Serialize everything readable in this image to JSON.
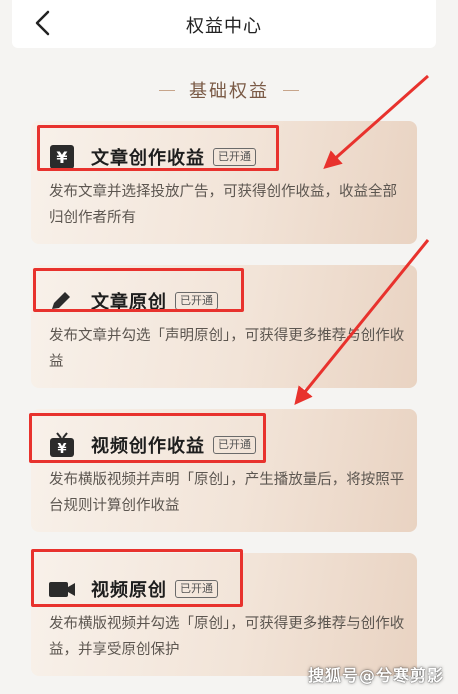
{
  "header": {
    "title": "权益中心"
  },
  "section": {
    "title": "基础权益"
  },
  "cards": [
    {
      "title": "文章创作收益",
      "badge": "已开通",
      "desc": "发布文章并选择投放广告，可获得创作收益，收益全部归创作者所有",
      "icon": "yuan-icon"
    },
    {
      "title": "文章原创",
      "badge": "已开通",
      "desc": "发布文章并勾选「声明原创」，可获得更多推荐与创作收益",
      "icon": "pen-icon"
    },
    {
      "title": "视频创作收益",
      "badge": "已开通",
      "desc": "发布横版视频并声明「原创」，产生播放量后，将按照平台规则计算创作收益",
      "icon": "tv-yuan-icon"
    },
    {
      "title": "视频原创",
      "badge": "已开通",
      "desc": "发布横版视频并勾选「原创」，可获得更多推荐与创作收益，并享受原创保护",
      "icon": "video-camera-icon"
    }
  ],
  "watermark": "搜狐号@兮寒剪影",
  "colors": {
    "highlight": "#e8322d",
    "accent": "#7a5a46",
    "card_bg": "#f2e4d8"
  }
}
